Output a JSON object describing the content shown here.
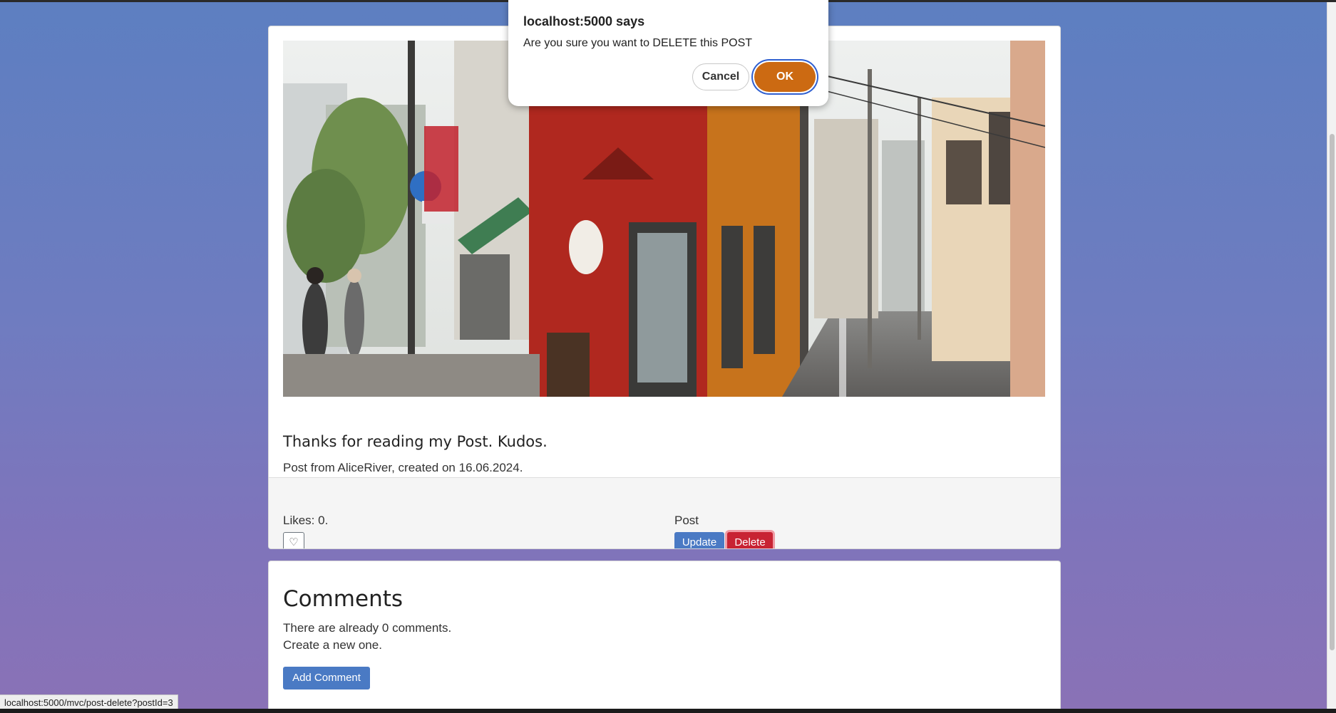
{
  "dialog": {
    "title": "localhost:5000 says",
    "message": "Are you sure you want to DELETE this POST",
    "cancel_label": "Cancel",
    "ok_label": "OK"
  },
  "post": {
    "title": "Thanks for reading my Post. Kudos.",
    "meta": "Post from AliceRiver, created on 16.06.2024.",
    "likes_text": "Likes: 0.",
    "like_icon": "heart-outline-icon",
    "actions_label": "Post",
    "update_label": "Update",
    "delete_label": "Delete"
  },
  "comments": {
    "heading": "Comments",
    "count_text": "There are already 0 comments.",
    "create_text": "Create a new one.",
    "add_label": "Add Comment"
  },
  "status_bar": {
    "url": "localhost:5000/mvc/post-delete?postId=3"
  },
  "colors": {
    "primary": "#4a7ac4",
    "danger": "#c82333",
    "dialog_ok": "#cc6a12"
  }
}
